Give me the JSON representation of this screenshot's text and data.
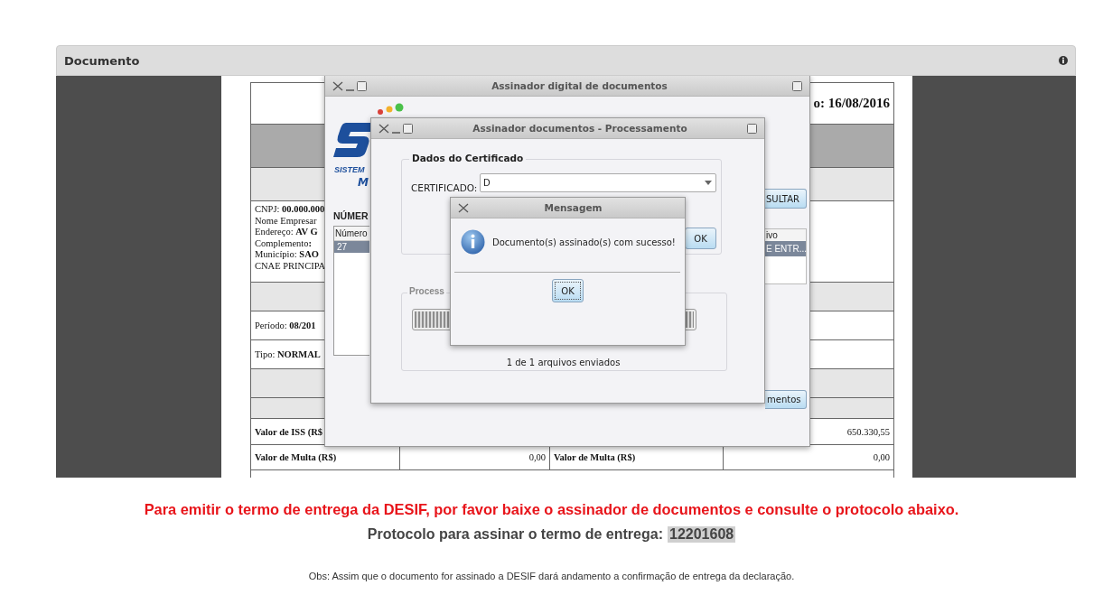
{
  "panel": {
    "title": "Documento"
  },
  "document": {
    "date_fragment": "o: 16/08/2016",
    "company_lines": [
      "CNPJ: **00.000.000**",
      "Nome Empresar",
      "Endereço: **AV G**",
      "Complemento**:**",
      "Município: **SAO**",
      "CNAE PRINCIPA"
    ],
    "period": "Período: **08/201**",
    "type": "Tipo: **NORMAL**",
    "iss_label": "Valor de ISS (R$",
    "iss_value": "650.330,55",
    "fine_row": [
      "Valor de Multa (R$)",
      "0,00",
      "Valor de Multa (R$)",
      "0,00"
    ]
  },
  "main_window": {
    "title": "Assinador digital de documentos",
    "logo_line_1": "SISTEM",
    "logo_line_2": "M",
    "number_label": "NÚMER",
    "list_header": "Número",
    "list_row": {
      "text": "27",
      "selected": true
    },
    "consult_button": "SULTAR",
    "file_header": "ivo",
    "file_row": {
      "text": "E ENTR...",
      "selected": true
    },
    "documents_button": "mentos"
  },
  "process_window": {
    "title": "Assinador documentos - Processamento",
    "certificate_group": "Dados do Certificado",
    "certificate_label": "CERTIFICADO:",
    "certificate_value": "D",
    "ok_button": "OK",
    "process_group": "Process",
    "progress": {
      "level": 1
    },
    "status": "1 de 1 arquivos enviados"
  },
  "dialog": {
    "title": "Mensagem",
    "message": "Documento(s) assinado(s) com sucesso!",
    "ok_button": "OK"
  },
  "footer": {
    "notice": "Para emitir o termo de entrega da DESIF, por favor baixe o assinador de documentos e consulte o protocolo abaixo.",
    "protocol_label": "Protocolo para assinar o termo de entrega:",
    "protocol_number": "12201608",
    "note": "Obs: Assim que o documento for assinado a DESIF dará andamento a confirmação de entrega da declaração."
  }
}
